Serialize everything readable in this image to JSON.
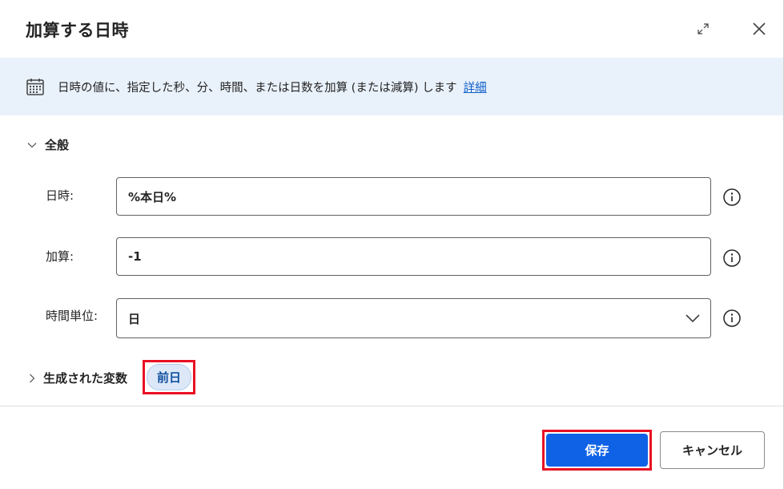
{
  "dialog": {
    "title": "加算する日時",
    "expand_icon": "expand-icon",
    "close_icon": "close-icon"
  },
  "banner": {
    "icon": "calendar-icon",
    "text": "日時の値に、指定した秒、分、時間、または日数を加算 (または減算) します",
    "link": "詳細"
  },
  "general": {
    "title": "全般",
    "fields": [
      {
        "label": "日時:",
        "value": "%本日%"
      },
      {
        "label": "加算:",
        "value": "-1"
      },
      {
        "label": "時間単位:",
        "value": "日"
      }
    ]
  },
  "generated": {
    "title": "生成された変数",
    "variable": "前日"
  },
  "footer": {
    "save_label": "保存",
    "cancel_label": "キャンセル"
  },
  "colors": {
    "accent": "#0f62e6",
    "banner_bg": "#e9f1fb",
    "highlight": "#e81123",
    "link": "#0f5fc9"
  }
}
